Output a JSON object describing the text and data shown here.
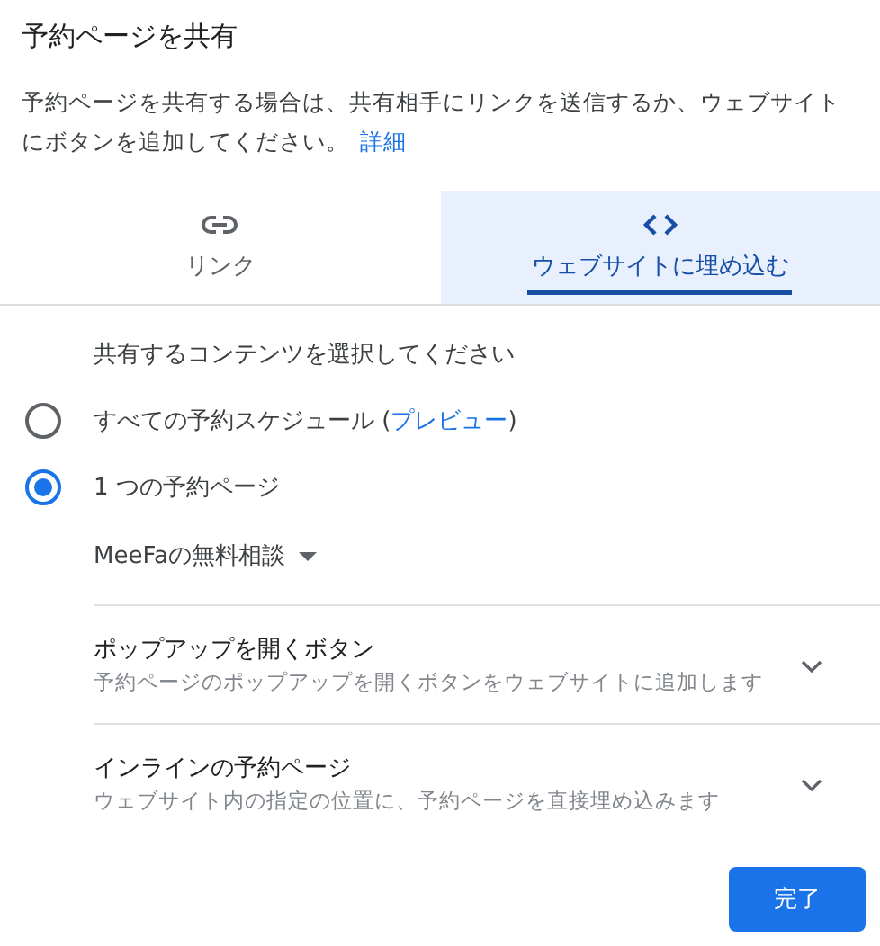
{
  "dialog": {
    "title": "予約ページを共有",
    "description": "予約ページを共有する場合は、共有相手にリンクを送信するか、ウェブサイトにボタンを追加してください。",
    "description_link": "詳細"
  },
  "tabs": [
    {
      "label": "リンク",
      "kind": "link",
      "selected": false
    },
    {
      "label": "ウェブサイトに埋め込む",
      "kind": "code",
      "selected": true
    }
  ],
  "content_prompt": "共有するコンテンツを選択してください",
  "options": [
    {
      "label": "すべての予約スケジュール (",
      "link": "プレビュー",
      "suffix": ")",
      "selected": false
    },
    {
      "label": "1 つの予約ページ",
      "selected": true
    }
  ],
  "page_dropdown": {
    "value": "MeeFaの無料相談"
  },
  "sections": [
    {
      "title": "ポップアップを開くボタン",
      "subtitle": "予約ページのポップアップを開くボタンをウェブサイトに追加します",
      "expanded": false
    },
    {
      "title": "インラインの予約ページ",
      "subtitle": "ウェブサイト内の指定の位置に、予約ページを直接埋め込みます",
      "expanded": false
    }
  ],
  "done_button": "完了"
}
